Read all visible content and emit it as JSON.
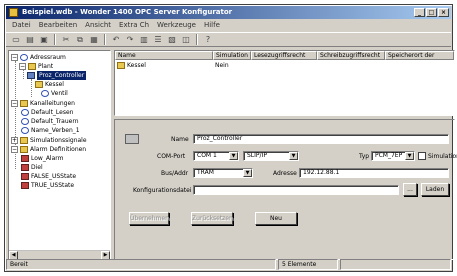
{
  "window": {
    "title": "Beispiel.wdb - Wonder 1400 OPC Server Konfigurator"
  },
  "menu": [
    "Datei",
    "Bearbeiten",
    "Ansicht",
    "Extra Ch",
    "Werkzeuge",
    "Hilfe"
  ],
  "tree": {
    "items": [
      {
        "label": "Adressraum"
      },
      {
        "label": "Plant"
      },
      {
        "label": "Proz_Controller"
      },
      {
        "label": "Kessel"
      },
      {
        "label": "Ventil"
      },
      {
        "label": "Kanalleitungen"
      },
      {
        "label": "Default_Lesen"
      },
      {
        "label": "Default_Trauern"
      },
      {
        "label": "Name_Verben_1"
      },
      {
        "label": "Simulationssignale"
      },
      {
        "label": "Alarm Definitionen"
      },
      {
        "label": "Low_Alarm"
      },
      {
        "label": "Diel"
      },
      {
        "label": "FALSE_USState"
      },
      {
        "label": "TRUE_USState"
      }
    ]
  },
  "list": {
    "columns": [
      "Name",
      "Simulation",
      "Lesezugriffsrecht",
      "Schreibzugriffsrecht",
      "Speicherort der"
    ],
    "rows": [
      {
        "name": "Kessel",
        "simulation": "Nein"
      }
    ]
  },
  "detail": {
    "name_label": "Name",
    "name_value": "Proz_Controller",
    "com_port_label": "COM-Port",
    "com_port_value": "COM 1",
    "protocol_value": "SLIP/IP",
    "typ_label": "Typ",
    "typ_value": "PCM_7EP",
    "simulation_label": "Simulation",
    "bus_label": "Bus/Addr",
    "bus_value": "TRAM",
    "address_label": "Adresse",
    "address_value": "192.12.88.1",
    "config_label": "Konfigurationsdatei",
    "config_value": "",
    "browse_label": "...",
    "load_label": "Laden",
    "btn_apply": "Übernehmen",
    "btn_reset": "Zurücksetzen",
    "btn_new": "Neu"
  },
  "status": {
    "left": "Bereit",
    "count": "5 Elemente"
  }
}
